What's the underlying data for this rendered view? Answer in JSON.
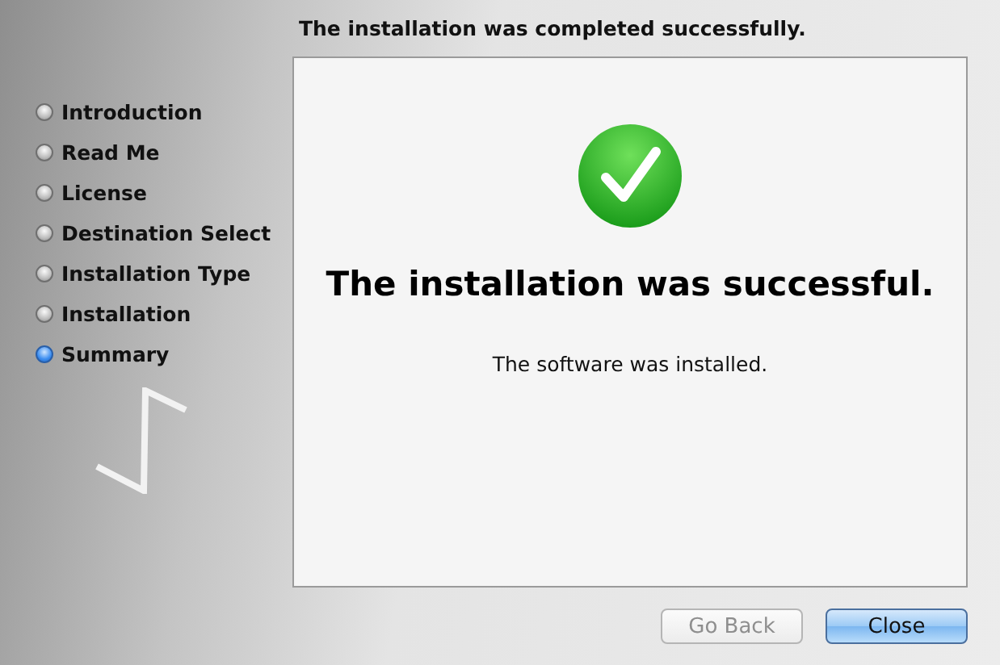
{
  "header": "The installation was completed successfully.",
  "steps": [
    {
      "label": "Introduction",
      "selected": false
    },
    {
      "label": "Read Me",
      "selected": false
    },
    {
      "label": "License",
      "selected": false
    },
    {
      "label": "Destination Select",
      "selected": false
    },
    {
      "label": "Installation Type",
      "selected": false
    },
    {
      "label": "Installation",
      "selected": false
    },
    {
      "label": "Summary",
      "selected": true
    }
  ],
  "panel": {
    "headline": "The installation was successful.",
    "message": "The software was installed."
  },
  "buttons": [
    {
      "label": "Go Back",
      "disabled": true,
      "default": false
    },
    {
      "label": "Close",
      "disabled": false,
      "default": true
    }
  ]
}
